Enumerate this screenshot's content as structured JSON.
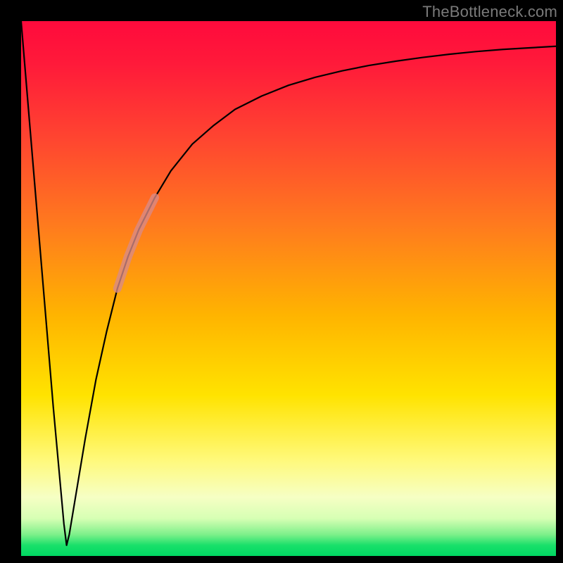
{
  "watermark": "TheBottleneck.com",
  "colors": {
    "frame": "#000000",
    "curve": "#000000",
    "highlight": "#d98b88",
    "gradient_stops": [
      "#ff0a3c",
      "#ff1a3a",
      "#ff4530",
      "#ff7a1e",
      "#ffb400",
      "#ffe300",
      "#fff97a",
      "#f6ffc4",
      "#d7ffb4",
      "#7df08a",
      "#19e06a",
      "#00d862"
    ]
  },
  "chart_data": {
    "type": "line",
    "title": "",
    "xlabel": "",
    "ylabel": "",
    "xlim": [
      0,
      100
    ],
    "ylim": [
      0,
      100
    ],
    "grid": false,
    "series": [
      {
        "name": "bottleneck-curve",
        "x": [
          0,
          2,
          4,
          6,
          8,
          8.5,
          9,
          10,
          12,
          14,
          16,
          18,
          20,
          22,
          25,
          28,
          32,
          36,
          40,
          45,
          50,
          55,
          60,
          65,
          70,
          75,
          80,
          85,
          90,
          95,
          100
        ],
        "y": [
          100,
          76,
          52,
          28,
          6,
          2,
          4,
          10,
          22,
          33,
          42,
          50,
          56,
          61,
          67,
          72,
          77,
          80.5,
          83.5,
          86,
          88,
          89.5,
          90.7,
          91.7,
          92.5,
          93.2,
          93.8,
          94.3,
          94.7,
          95,
          95.3
        ]
      }
    ],
    "highlight_segment": {
      "series": "bottleneck-curve",
      "x_range": [
        18,
        25
      ],
      "note": "light pink overlay band on the rising limb"
    },
    "annotations": [
      {
        "text": "TheBottleneck.com",
        "position": "top-right"
      }
    ]
  }
}
